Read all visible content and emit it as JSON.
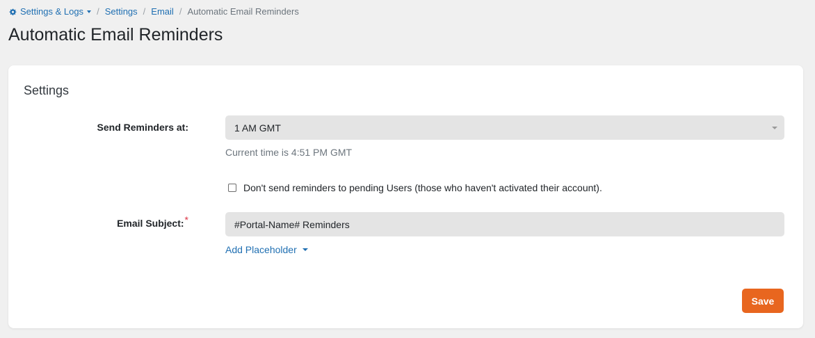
{
  "breadcrumb": {
    "root": "Settings & Logs",
    "items": [
      "Settings",
      "Email"
    ],
    "current": "Automatic Email Reminders",
    "root_icon": "gear-icon"
  },
  "page": {
    "title": "Automatic Email Reminders"
  },
  "card": {
    "title": "Settings",
    "send_reminders": {
      "label": "Send Reminders at:",
      "value": "1 AM GMT",
      "help": "Current time is 4:51 PM GMT"
    },
    "pending_checkbox": {
      "label": "Don't send reminders to pending Users (those who haven't activated their account).",
      "checked": false
    },
    "email_subject": {
      "label": "Email Subject:",
      "required_mark": "*",
      "value": "#Portal-Name# Reminders"
    },
    "add_placeholder": "Add Placeholder",
    "save_label": "Save"
  },
  "colors": {
    "link": "#1f6fb2",
    "accent": "#e8661f",
    "required": "#dc3545"
  }
}
